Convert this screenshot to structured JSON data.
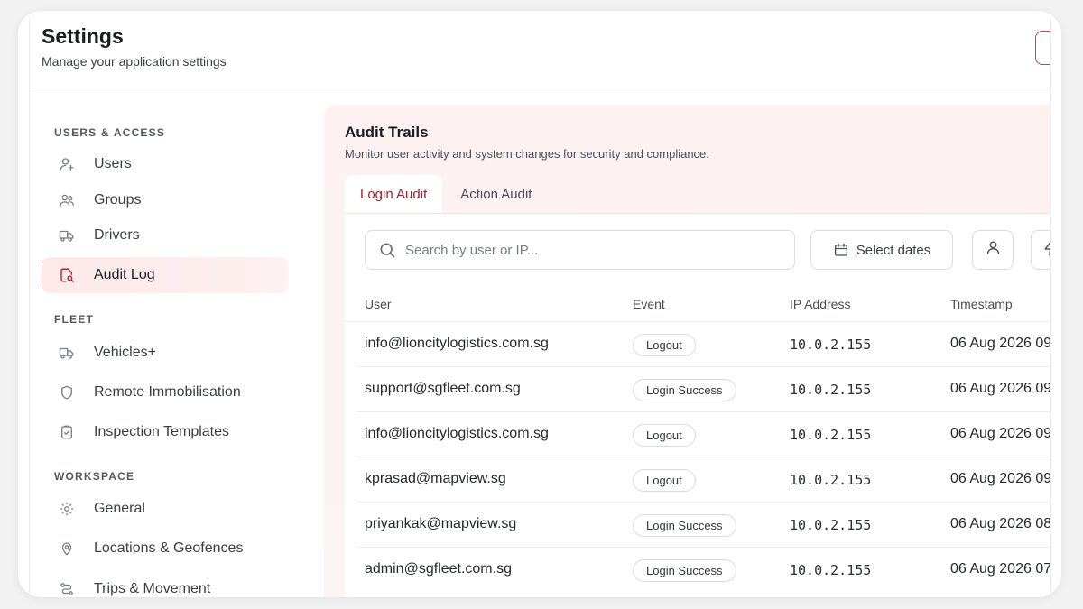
{
  "header": {
    "title": "Settings",
    "subtitle": "Manage your application settings"
  },
  "sidebar": {
    "sections": [
      {
        "label": "USERS & ACCESS"
      },
      {
        "label": "FLEET"
      },
      {
        "label": "WORKSPACE"
      }
    ],
    "items": [
      {
        "label": "Users",
        "icon": "user-plus-icon"
      },
      {
        "label": "Groups",
        "icon": "users-icon"
      },
      {
        "label": "Drivers",
        "icon": "truck-icon"
      },
      {
        "label": "Audit Log",
        "icon": "audit-log-icon",
        "active": true
      },
      {
        "label": "Vehicles+",
        "icon": "truck-icon"
      },
      {
        "label": "Remote Immobilisation",
        "icon": "shield-icon"
      },
      {
        "label": "Inspection Templates",
        "icon": "clipboard-check-icon"
      },
      {
        "label": "General",
        "icon": "gear-icon"
      },
      {
        "label": "Locations & Geofences",
        "icon": "map-pin-icon"
      },
      {
        "label": "Trips & Movement",
        "icon": "route-icon"
      }
    ]
  },
  "content": {
    "title": "Audit Trails",
    "subtitle": "Monitor user activity and system changes for security and compliance.",
    "tabs": [
      {
        "label": "Login Audit",
        "active": true
      },
      {
        "label": "Action Audit",
        "active": false
      }
    ]
  },
  "filters": {
    "search_placeholder": "Search by user or IP...",
    "date_label": "Select dates"
  },
  "table": {
    "columns": [
      "User",
      "Event",
      "IP Address",
      "Timestamp"
    ],
    "rows": [
      {
        "user": "info@lioncitylogistics.com.sg",
        "event": "Logout",
        "ip": "10.0.2.155",
        "timestamp": "06 Aug 2026 09"
      },
      {
        "user": "support@sgfleet.com.sg",
        "event": "Login Success",
        "ip": "10.0.2.155",
        "timestamp": "06 Aug 2026 09"
      },
      {
        "user": "info@lioncitylogistics.com.sg",
        "event": "Logout",
        "ip": "10.0.2.155",
        "timestamp": "06 Aug 2026 09"
      },
      {
        "user": "kprasad@mapview.sg",
        "event": "Logout",
        "ip": "10.0.2.155",
        "timestamp": "06 Aug 2026 09"
      },
      {
        "user": "priyankak@mapview.sg",
        "event": "Login Success",
        "ip": "10.0.2.155",
        "timestamp": "06 Aug 2026 08"
      },
      {
        "user": "admin@sgfleet.com.sg",
        "event": "Login Success",
        "ip": "10.0.2.155",
        "timestamp": "06 Aug 2026 07"
      }
    ]
  },
  "colors": {
    "accent": "#b52a37",
    "active_bg": "#fde9ea",
    "content_bg": "#fdf1f1"
  }
}
